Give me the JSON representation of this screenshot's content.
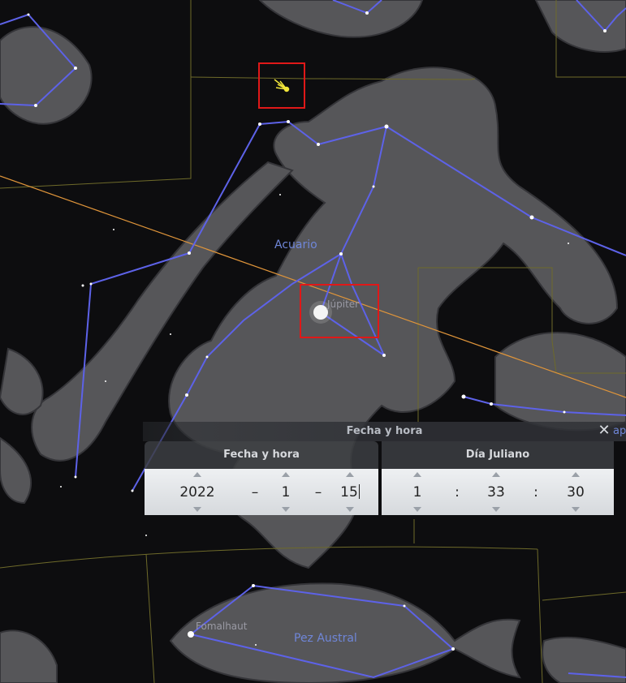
{
  "sky": {
    "labels": {
      "aquarius": "Acuario",
      "jupiter": "Júpiter",
      "fomalhaut": "Fomalhaut",
      "piscis_austrinus": "Pez Austral"
    },
    "colors": {
      "background": "#0d0d0f",
      "constellation_lines": "#5d62e8",
      "constellation_labels": "#6f86d8",
      "boundaries": "#6e6a2a",
      "ecliptic": "#e0953a",
      "selection": "#e01818",
      "comet": "#f2e63a"
    },
    "selected_objects": [
      "comet-marker",
      "jupiter"
    ]
  },
  "dialog": {
    "title": "Fecha y hora",
    "close_icon": "close-icon",
    "edge_text": "api",
    "date_panel": {
      "header": "Fecha y hora",
      "year": "2022",
      "month": "1",
      "day": "15",
      "separator": "–"
    },
    "jd_panel": {
      "header": "Día Juliano",
      "hour": "1",
      "minute": "33",
      "second": "30",
      "separator": ":"
    }
  }
}
